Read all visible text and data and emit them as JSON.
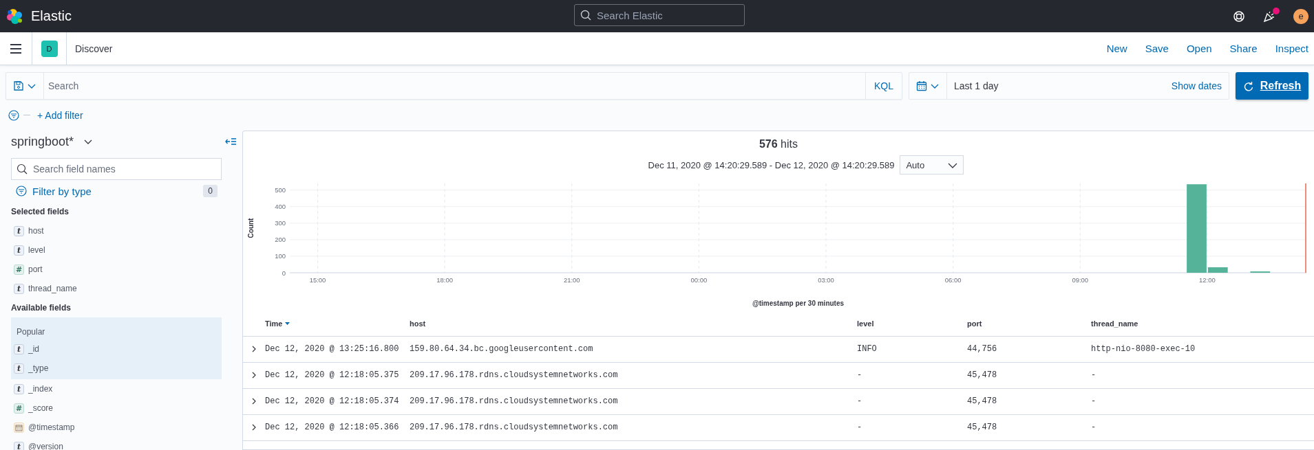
{
  "header": {
    "brand": "Elastic",
    "search": {
      "placeholder": "Search Elastic"
    },
    "news_unread": true,
    "avatar": "e"
  },
  "nav": {
    "app_badge": "D",
    "title": "Discover",
    "links": [
      "New",
      "Save",
      "Open",
      "Share",
      "Inspect"
    ]
  },
  "query_bar": {
    "search": {
      "placeholder": "Search"
    },
    "language": "KQL",
    "time_range": "Last 1 day",
    "show_dates": "Show dates",
    "refresh": "Refresh"
  },
  "filter_bar": {
    "add_filter": "+ Add filter"
  },
  "sidebar": {
    "index_pattern": "springboot*",
    "field_search": {
      "placeholder": "Search field names"
    },
    "filter_by_type": "Filter by type",
    "filter_count": "0",
    "selected_heading": "Selected fields",
    "selected_fields": [
      {
        "name": "host",
        "kind": "string",
        "token": "t"
      },
      {
        "name": "level",
        "kind": "string",
        "token": "t"
      },
      {
        "name": "port",
        "kind": "number",
        "token": "#"
      },
      {
        "name": "thread_name",
        "kind": "string",
        "token": "t"
      }
    ],
    "available_heading": "Available fields",
    "popular": {
      "label": "Popular",
      "fields": [
        {
          "name": "_id",
          "kind": "string",
          "token": "t"
        },
        {
          "name": "_type",
          "kind": "string",
          "token": "t"
        }
      ]
    },
    "available_fields": [
      {
        "name": "_index",
        "kind": "string",
        "token": "t"
      },
      {
        "name": "_score",
        "kind": "number",
        "token": "#"
      },
      {
        "name": "@timestamp",
        "kind": "date"
      },
      {
        "name": "@version",
        "kind": "string",
        "token": "t"
      }
    ]
  },
  "results": {
    "hits": "**576** hits",
    "time_span": "Dec 11, 2020 @ 14:20:29.589 - Dec 12, 2020 @ 14:20:29.589",
    "interval": "Auto",
    "chart_data": {
      "type": "bar",
      "xlabel": "@timestamp per 30 minutes",
      "ylabel": "Count",
      "grid": true,
      "x": [
        "2020-12-12T11:45",
        "2020-12-12T12:15",
        "2020-12-12T13:15"
      ],
      "values": [
        535,
        33,
        8
      ],
      "xlim": [
        "2020-12-11T14:20:29.589",
        "2020-12-12T14:20:29.589"
      ],
      "ylim": [
        0,
        540
      ],
      "xticks": [
        {
          "value": "2020-12-11T15:00",
          "label": "15:00"
        },
        {
          "value": "2020-12-11T18:00",
          "label": "18:00"
        },
        {
          "value": "2020-12-11T21:00",
          "label": "21:00"
        },
        {
          "value": "2020-12-12T00:00",
          "label": "00:00"
        },
        {
          "value": "2020-12-12T03:00",
          "label": "03:00"
        },
        {
          "value": "2020-12-12T06:00",
          "label": "06:00"
        },
        {
          "value": "2020-12-12T09:00",
          "label": "09:00"
        },
        {
          "value": "2020-12-12T12:00",
          "label": "12:00"
        }
      ],
      "yticks": [
        0,
        100,
        200,
        300,
        400,
        500
      ]
    },
    "table": {
      "columns": [
        {
          "label": "Time",
          "sorted": true
        },
        {
          "label": "host",
          "sorted": false
        },
        {
          "label": "level",
          "sorted": false
        },
        {
          "label": "port",
          "sorted": false
        },
        {
          "label": "thread_name",
          "sorted": false
        }
      ],
      "rows": [
        {
          "expanded": false,
          "cells": [
            "Dec 12, 2020 @ 13:25:16.800",
            "159.80.64.34.bc.googleusercontent.com",
            "INFO",
            "44,756",
            "http-nio-8080-exec-10"
          ]
        },
        {
          "expanded": false,
          "cells": [
            "Dec 12, 2020 @ 12:18:05.375",
            "209.17.96.178.rdns.cloudsystemnetworks.com",
            "-",
            "45,478",
            "-"
          ]
        },
        {
          "expanded": false,
          "cells": [
            "Dec 12, 2020 @ 12:18:05.374",
            "209.17.96.178.rdns.cloudsystemnetworks.com",
            "-",
            "45,478",
            "-"
          ]
        },
        {
          "expanded": false,
          "cells": [
            "Dec 12, 2020 @ 12:18:05.366",
            "209.17.96.178.rdns.cloudsystemnetworks.com",
            "-",
            "45,478",
            "-"
          ]
        }
      ]
    }
  }
}
